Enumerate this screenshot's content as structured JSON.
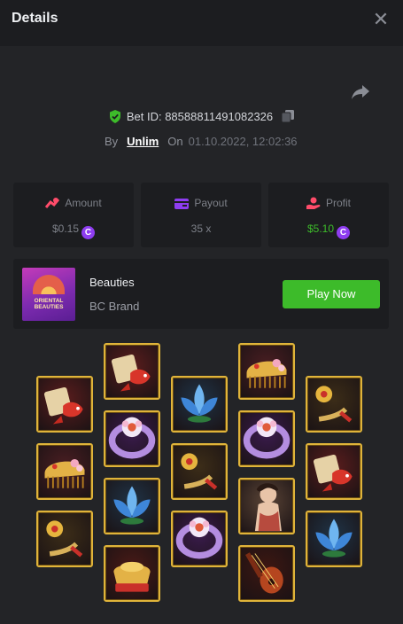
{
  "header": {
    "title": "Details",
    "close_label": "✕"
  },
  "bet": {
    "id_label": "Bet ID: 88588811491082326",
    "by_label": "By",
    "user": "Unlim",
    "on_label": "On",
    "date": "01.10.2022, 12:02:36"
  },
  "stats": [
    {
      "label": "Amount",
      "value": "$0.15",
      "coin": "C",
      "value_color": "#7d8088",
      "icon_color": "#ff4c6a"
    },
    {
      "label": "Payout",
      "value": "35 x",
      "coin": "",
      "value_color": "#7d8088",
      "icon_color": "#8e3df0"
    },
    {
      "label": "Profit",
      "value": "$5.10",
      "coin": "C",
      "value_color": "#3dbb2a",
      "icon_color": "#ff4c6a"
    }
  ],
  "game": {
    "name": "Beauties",
    "brand": "BC Brand",
    "play_label": "Play Now",
    "thumb_text": "ORIENTAL BEAUTIES"
  },
  "reels": [
    [
      "fan-koi",
      "comb",
      "jade-hairpin"
    ],
    [
      "fan-koi",
      "ring",
      "lotus",
      "gold-ingots"
    ],
    [
      "lotus",
      "jade-hairpin",
      "ring"
    ],
    [
      "comb",
      "ring",
      "beauty-lady",
      "pipa-lute"
    ],
    [
      "jade-hairpin",
      "fan-koi",
      "lotus"
    ]
  ],
  "colors": {
    "accent_green": "#3dbb2a",
    "coin_purple": "#8e3df0",
    "tile_border": "#e0b43a"
  }
}
